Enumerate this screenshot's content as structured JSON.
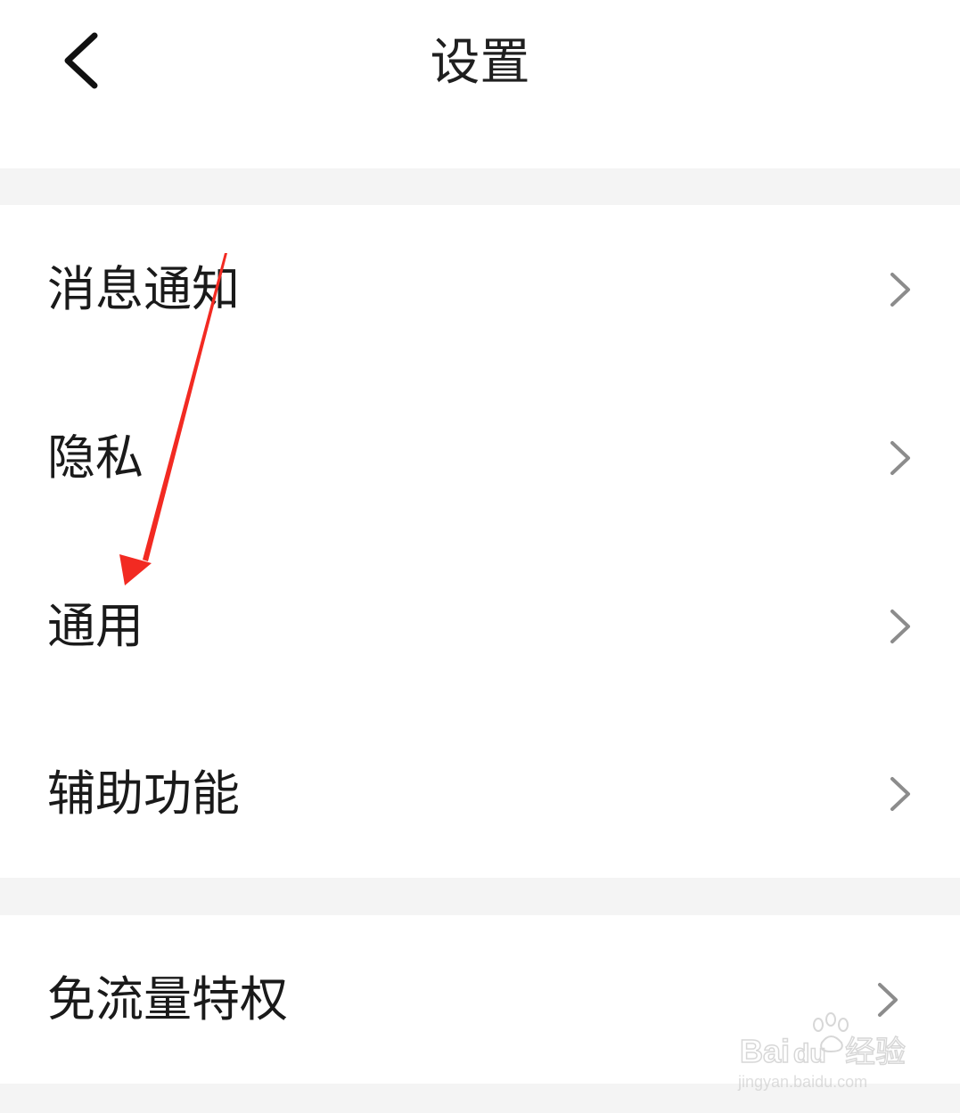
{
  "header": {
    "title": "设置",
    "back_icon": "chevron-left-icon"
  },
  "settings": {
    "group1": [
      {
        "label": "消息通知",
        "icon": "chevron-right-icon"
      },
      {
        "label": "隐私",
        "icon": "chevron-right-icon"
      },
      {
        "label": "通用",
        "icon": "chevron-right-icon"
      },
      {
        "label": "辅助功能",
        "icon": "chevron-right-icon"
      }
    ],
    "group2": [
      {
        "label": "免流量特权",
        "icon": "chevron-right-icon"
      }
    ]
  },
  "annotation": {
    "arrow_color": "#f22a22",
    "points_to": "通用"
  },
  "watermark": {
    "brand": "Baidu经验",
    "url": "jingyan.baidu.com"
  },
  "colors": {
    "background": "#ffffff",
    "separator": "#f4f4f4",
    "text": "#1a1a1a",
    "chevron": "#8c8c8c"
  }
}
